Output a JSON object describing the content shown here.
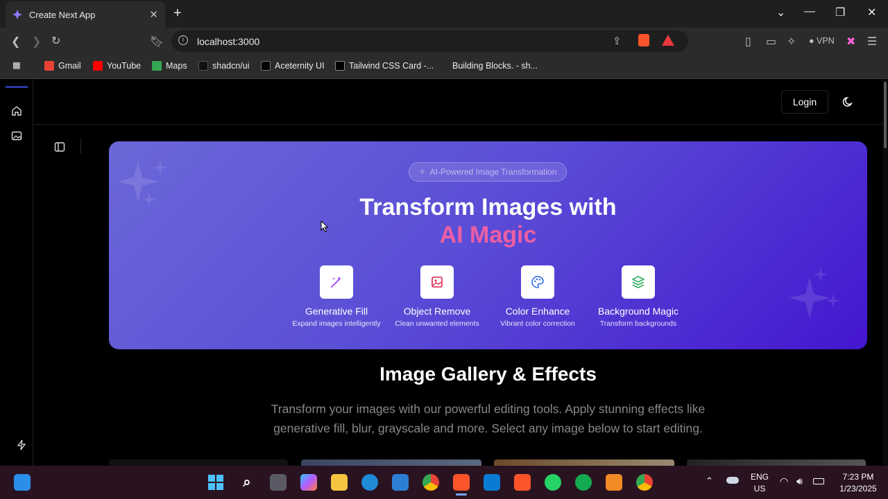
{
  "browser": {
    "tab_title": "Create Next App",
    "url": "localhost:3000",
    "vpn_label": "VPN",
    "bookmarks": [
      "Gmail",
      "YouTube",
      "Maps",
      "shadcn/ui",
      "Aceternity UI",
      "Tailwind CSS Card -...",
      "Building Blocks. - sh..."
    ]
  },
  "header": {
    "login_label": "Login"
  },
  "hero": {
    "badge": "AI-Powered Image Transformation",
    "title_line1": "Transform Images with",
    "title_line2": "AI Magic",
    "features": [
      {
        "title": "Generative Fill",
        "subtitle": "Expand images intelligently",
        "icon": "wand-icon",
        "color": "#a855f7"
      },
      {
        "title": "Object Remove",
        "subtitle": "Clean unwanted elements",
        "icon": "image-icon",
        "color": "#e11d48"
      },
      {
        "title": "Color Enhance",
        "subtitle": "Vibrant color correction",
        "icon": "palette-icon",
        "color": "#2563eb"
      },
      {
        "title": "Background Magic",
        "subtitle": "Transform backgrounds",
        "icon": "layers-icon",
        "color": "#16a34a"
      }
    ]
  },
  "gallery": {
    "title": "Image Gallery & Effects",
    "description": "Transform your images with our powerful editing tools. Apply stunning effects like generative fill, blur, grayscale and more. Select any image below to start editing."
  },
  "taskbar": {
    "lang_line1": "ENG",
    "lang_line2": "US",
    "time": "7:23 PM",
    "date": "1/23/2025"
  },
  "colors": {
    "hero_start": "#6a68d8",
    "hero_end": "#4416cf",
    "accent_pink": "#ec5fa3"
  }
}
